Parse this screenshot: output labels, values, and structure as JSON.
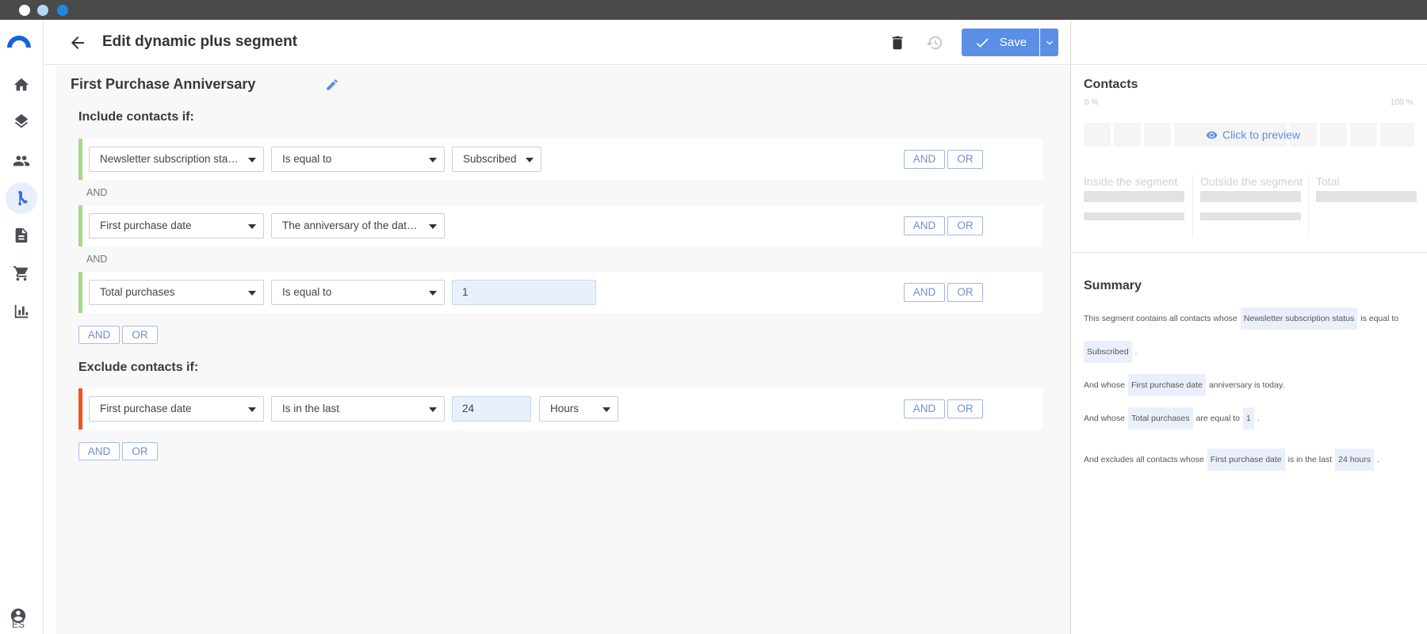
{
  "titlebar": {
    "dots": [
      "#ffffff",
      "#b7d7f3",
      "#1e88e5"
    ]
  },
  "sidebar": {
    "items": [
      {
        "name": "home",
        "icon": "home-icon"
      },
      {
        "name": "layers",
        "icon": "layers-icon"
      },
      {
        "name": "contacts",
        "icon": "people-icon"
      },
      {
        "name": "segments",
        "icon": "branch-icon",
        "active": true
      },
      {
        "name": "documents",
        "icon": "document-icon"
      },
      {
        "name": "ecommerce",
        "icon": "cart-icon"
      },
      {
        "name": "reports",
        "icon": "bar-chart-icon"
      }
    ],
    "language": "ES"
  },
  "header": {
    "title": "Edit dynamic plus segment",
    "save_label": "Save"
  },
  "segment": {
    "name": "First Purchase Anniversary",
    "include_title": "Include contacts if:",
    "exclude_title": "Exclude contacts if:",
    "join_label": "AND",
    "and_label": "AND",
    "or_label": "OR",
    "include_rules": [
      {
        "field": "Newsletter subscription status",
        "operator": "Is equal to",
        "value": "Subscribed"
      },
      {
        "field": "First purchase date",
        "operator": "The anniversary of the date is today"
      },
      {
        "field": "Total purchases",
        "operator": "Is equal to",
        "value": "1"
      }
    ],
    "exclude_rules": [
      {
        "field": "First purchase date",
        "operator": "Is in the last",
        "value": "24",
        "unit": "Hours"
      }
    ]
  },
  "contacts_panel": {
    "title": "Contacts",
    "pct_min": "0 %",
    "pct_max": "100 %",
    "preview_label": "Click to preview",
    "inside_label": "Inside the segment",
    "outside_label": "Outside the segment",
    "total_label": "Total"
  },
  "summary": {
    "title": "Summary",
    "line1_text": "This segment contains all contacts whose",
    "line1_chip": "Newsletter subscription status",
    "line1_after": "is equal to",
    "line2_chip": "Subscribed",
    "line2_after": ".",
    "line3_text": "And whose",
    "line3_chip": "First purchase date",
    "line3_after": "anniversary is today.",
    "line4_text": "And whose",
    "line4_chip": "Total purchases",
    "line4_mid": "are equal to",
    "line4_chip2": "1",
    "line4_after": ".",
    "line5_text": "And excludes all contacts whose",
    "line5_chip": "First purchase date",
    "line5_mid": "is in the last",
    "line5_chip2": "24 hours",
    "line5_after": "."
  },
  "colors": {
    "accent": "#5b8fe6",
    "include_bar": "#a8d88a",
    "exclude_bar": "#f4511e"
  }
}
